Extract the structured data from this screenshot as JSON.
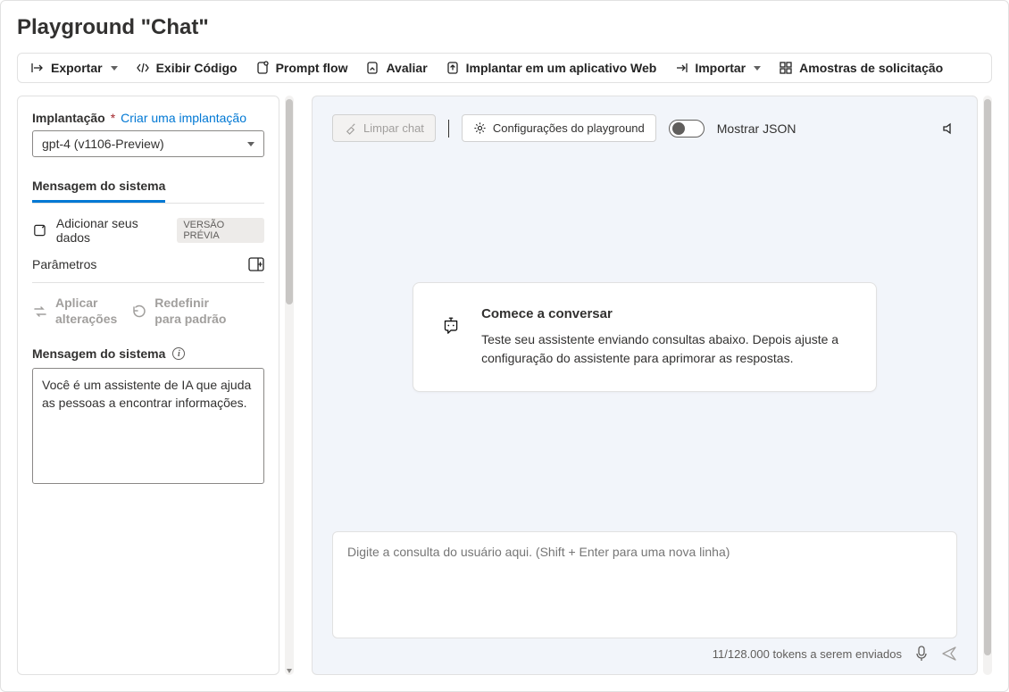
{
  "page": {
    "title": "Playground \"Chat\""
  },
  "toolbar": {
    "export": "Exportar",
    "showCode": "Exibir Código",
    "promptFlow": "Prompt flow",
    "evaluate": "Avaliar",
    "deployWeb": "Implantar em um aplicativo Web",
    "import": "Importar",
    "samples": "Amostras de solicitação"
  },
  "sidebar": {
    "deployment": {
      "label": "Implantação",
      "createLink": "Criar uma implantação",
      "selected": "gpt-4 (v1106-Preview)"
    },
    "tab": {
      "systemMessage": "Mensagem do sistema"
    },
    "addData": {
      "label": "Adicionar seus dados",
      "badge": "VERSÃO PRÉVIA"
    },
    "parameters": {
      "label": "Parâmetros"
    },
    "actions": {
      "applyLine1": "Aplicar",
      "applyLine2": "alterações",
      "resetLine1": "Redefinir",
      "resetLine2": "para padrão"
    },
    "systemMessage": {
      "label": "Mensagem do sistema",
      "value": "Você é um assistente de IA que ajuda as pessoas a encontrar informações."
    }
  },
  "chat": {
    "clear": "Limpar chat",
    "settings": "Configurações do playground",
    "showJsonLabel": "Mostrar JSON",
    "showJson": false,
    "welcome": {
      "title": "Comece a conversar",
      "body": "Teste seu assistente enviando consultas abaixo. Depois ajuste a configuração do assistente para aprimorar as respostas."
    },
    "inputPlaceholder": "Digite a consulta do usuário aqui. (Shift + Enter para uma nova linha)",
    "tokens": "11/128.000 tokens a serem enviados"
  }
}
